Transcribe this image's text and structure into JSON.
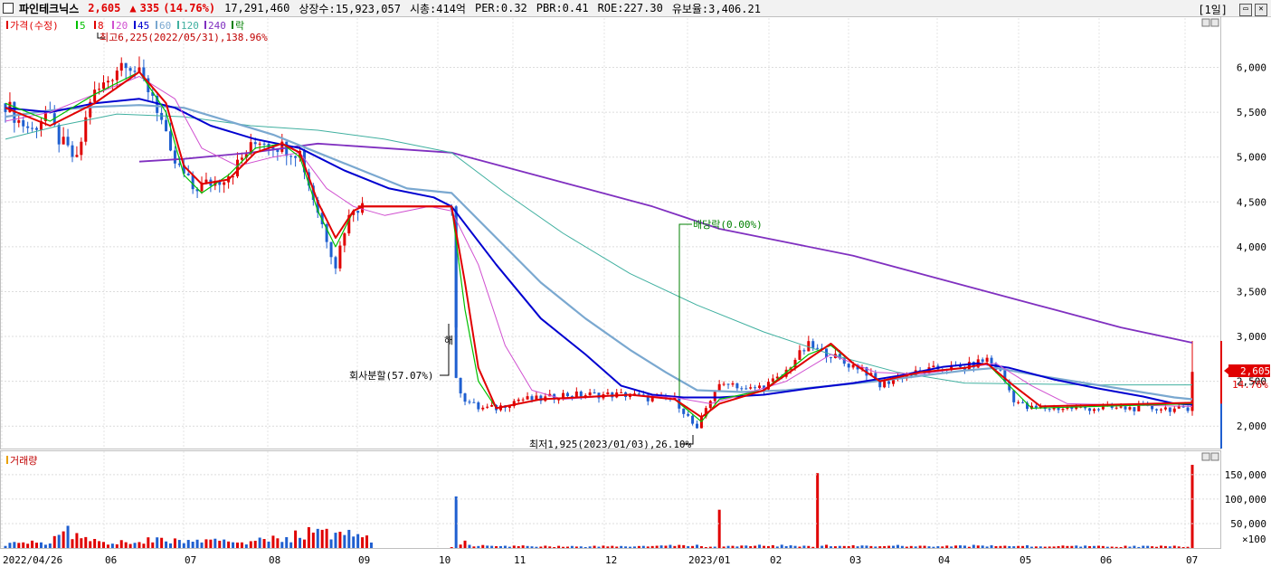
{
  "header": {
    "name": "파인테크닉스",
    "price": "2,605",
    "arrow": "▲",
    "change": "335",
    "change_pct": "(14.76%)",
    "volume": "17,291,460",
    "listed": "상장수:15,923,057",
    "mcap": "시총:414억",
    "per": "PER:0.32",
    "pbr": "PBR:0.41",
    "roe": "ROE:227.30",
    "reserve": "유보율:3,406.21",
    "period": "[1일]"
  },
  "legend": {
    "price_label": "가격(수정)",
    "ma": [
      "5",
      "8",
      "20",
      "45",
      "60",
      "120",
      "240"
    ],
    "ex_label": "락",
    "colors": {
      "ma5": "#00c000",
      "ma8": "#e00000",
      "ma20": "#d050d0",
      "ma45": "#0000d0",
      "ma60": "#7aa8d0",
      "ma120": "#40b0a0",
      "ma240": "#8030c0"
    }
  },
  "annotations": {
    "high": "최고6,225(2022/05/31),138.96%",
    "low": "최저1,925(2023/01/03),26.10%",
    "split": "회사분할(57.07%)",
    "split_mark": "해",
    "dividend": "배당락(0.00%)",
    "last_price": "2,605",
    "last_pct": "14.76%"
  },
  "volume_panel": {
    "label": "거래량",
    "unit": "×100",
    "ticks": [
      "150,000",
      "100,000",
      "50,000"
    ]
  },
  "chart_data": {
    "type": "candlestick",
    "y_ticks": [
      2000,
      2500,
      3000,
      3500,
      4000,
      4500,
      5000,
      5500,
      6000
    ],
    "ylim": [
      1750,
      6550
    ],
    "x_labels": [
      "2022/04/26",
      "06",
      "07",
      "08",
      "09",
      "10",
      "11",
      "12",
      "2023/01",
      "02",
      "03",
      "04",
      "05",
      "06",
      "07"
    ],
    "price_path": [
      [
        0,
        5600
      ],
      [
        3,
        5400
      ],
      [
        6,
        5300
      ],
      [
        9,
        5500
      ],
      [
        12,
        5200
      ],
      [
        16,
        4950
      ],
      [
        19,
        5650
      ],
      [
        22,
        5800
      ],
      [
        25,
        6000
      ],
      [
        27,
        6100
      ],
      [
        30,
        5900
      ],
      [
        33,
        5700
      ],
      [
        35,
        5400
      ],
      [
        37,
        5000
      ],
      [
        40,
        4800
      ],
      [
        42,
        4650
      ],
      [
        45,
        4700
      ],
      [
        48,
        4750
      ],
      [
        51,
        4850
      ],
      [
        54,
        5050
      ],
      [
        57,
        5200
      ],
      [
        60,
        5150
      ],
      [
        63,
        5100
      ],
      [
        66,
        5050
      ],
      [
        68,
        4700
      ],
      [
        70,
        4400
      ],
      [
        72,
        4100
      ],
      [
        74,
        3800
      ],
      [
        76,
        4200
      ],
      [
        78,
        4450
      ],
      [
        80,
        4450
      ],
      [
        100,
        4450
      ],
      [
        101,
        2500
      ],
      [
        103,
        2300
      ],
      [
        106,
        2200
      ],
      [
        110,
        2200
      ],
      [
        115,
        2300
      ],
      [
        120,
        2300
      ],
      [
        125,
        2350
      ],
      [
        130,
        2350
      ],
      [
        135,
        2350
      ],
      [
        140,
        2350
      ],
      [
        145,
        2300
      ],
      [
        150,
        2300
      ],
      [
        153,
        2100
      ],
      [
        155,
        1950
      ],
      [
        157,
        2200
      ],
      [
        159,
        2400
      ],
      [
        162,
        2500
      ],
      [
        166,
        2400
      ],
      [
        170,
        2450
      ],
      [
        174,
        2550
      ],
      [
        177,
        2750
      ],
      [
        180,
        2900
      ],
      [
        182,
        2850
      ],
      [
        185,
        2800
      ],
      [
        188,
        2700
      ],
      [
        192,
        2650
      ],
      [
        196,
        2450
      ],
      [
        200,
        2550
      ],
      [
        205,
        2600
      ],
      [
        210,
        2650
      ],
      [
        215,
        2650
      ],
      [
        220,
        2750
      ],
      [
        223,
        2600
      ],
      [
        226,
        2300
      ],
      [
        229,
        2200
      ],
      [
        234,
        2200
      ],
      [
        240,
        2200
      ],
      [
        245,
        2200
      ],
      [
        250,
        2200
      ],
      [
        255,
        2200
      ],
      [
        260,
        2200
      ],
      [
        265,
        2170
      ],
      [
        266,
        2605
      ]
    ],
    "ma5": [
      [
        0,
        5600
      ],
      [
        10,
        5400
      ],
      [
        20,
        5700
      ],
      [
        30,
        5950
      ],
      [
        36,
        5500
      ],
      [
        40,
        4800
      ],
      [
        44,
        4600
      ],
      [
        50,
        4800
      ],
      [
        56,
        5100
      ],
      [
        62,
        5150
      ],
      [
        66,
        5000
      ],
      [
        70,
        4400
      ],
      [
        74,
        4000
      ],
      [
        78,
        4400
      ],
      [
        80,
        4450
      ],
      [
        100,
        4450
      ],
      [
        103,
        3300
      ],
      [
        106,
        2500
      ],
      [
        110,
        2200
      ],
      [
        120,
        2300
      ],
      [
        140,
        2350
      ],
      [
        150,
        2300
      ],
      [
        156,
        2050
      ],
      [
        160,
        2300
      ],
      [
        170,
        2400
      ],
      [
        180,
        2800
      ],
      [
        185,
        2900
      ],
      [
        190,
        2700
      ],
      [
        196,
        2500
      ],
      [
        205,
        2600
      ],
      [
        215,
        2650
      ],
      [
        220,
        2700
      ],
      [
        226,
        2400
      ],
      [
        230,
        2200
      ],
      [
        266,
        2250
      ]
    ],
    "ma8": [
      [
        0,
        5550
      ],
      [
        10,
        5350
      ],
      [
        20,
        5600
      ],
      [
        30,
        5950
      ],
      [
        36,
        5600
      ],
      [
        40,
        4900
      ],
      [
        44,
        4700
      ],
      [
        50,
        4750
      ],
      [
        56,
        5050
      ],
      [
        62,
        5150
      ],
      [
        66,
        5050
      ],
      [
        70,
        4500
      ],
      [
        74,
        4100
      ],
      [
        78,
        4400
      ],
      [
        80,
        4450
      ],
      [
        100,
        4450
      ],
      [
        103,
        3600
      ],
      [
        106,
        2650
      ],
      [
        110,
        2200
      ],
      [
        120,
        2300
      ],
      [
        140,
        2350
      ],
      [
        150,
        2300
      ],
      [
        156,
        2100
      ],
      [
        160,
        2250
      ],
      [
        170,
        2400
      ],
      [
        180,
        2750
      ],
      [
        185,
        2920
      ],
      [
        190,
        2700
      ],
      [
        196,
        2500
      ],
      [
        205,
        2600
      ],
      [
        215,
        2650
      ],
      [
        220,
        2700
      ],
      [
        226,
        2450
      ],
      [
        232,
        2220
      ],
      [
        266,
        2260
      ]
    ],
    "ma20": [
      [
        0,
        5400
      ],
      [
        10,
        5500
      ],
      [
        20,
        5700
      ],
      [
        30,
        5900
      ],
      [
        38,
        5650
      ],
      [
        44,
        5100
      ],
      [
        52,
        4900
      ],
      [
        60,
        5000
      ],
      [
        66,
        5050
      ],
      [
        72,
        4650
      ],
      [
        78,
        4450
      ],
      [
        85,
        4350
      ],
      [
        95,
        4450
      ],
      [
        100,
        4400
      ],
      [
        106,
        3800
      ],
      [
        112,
        2900
      ],
      [
        118,
        2400
      ],
      [
        125,
        2300
      ],
      [
        140,
        2350
      ],
      [
        150,
        2320
      ],
      [
        158,
        2250
      ],
      [
        165,
        2350
      ],
      [
        175,
        2500
      ],
      [
        185,
        2800
      ],
      [
        195,
        2600
      ],
      [
        205,
        2580
      ],
      [
        215,
        2650
      ],
      [
        222,
        2700
      ],
      [
        230,
        2450
      ],
      [
        238,
        2250
      ],
      [
        266,
        2220
      ]
    ],
    "ma45": [
      [
        0,
        5550
      ],
      [
        10,
        5500
      ],
      [
        20,
        5600
      ],
      [
        30,
        5650
      ],
      [
        38,
        5550
      ],
      [
        46,
        5350
      ],
      [
        56,
        5200
      ],
      [
        66,
        5100
      ],
      [
        76,
        4850
      ],
      [
        86,
        4650
      ],
      [
        96,
        4550
      ],
      [
        100,
        4450
      ],
      [
        110,
        3800
      ],
      [
        120,
        3200
      ],
      [
        130,
        2800
      ],
      [
        138,
        2450
      ],
      [
        145,
        2350
      ],
      [
        152,
        2320
      ],
      [
        160,
        2320
      ],
      [
        170,
        2350
      ],
      [
        180,
        2420
      ],
      [
        190,
        2480
      ],
      [
        200,
        2560
      ],
      [
        210,
        2660
      ],
      [
        218,
        2700
      ],
      [
        225,
        2650
      ],
      [
        235,
        2520
      ],
      [
        245,
        2420
      ],
      [
        255,
        2330
      ],
      [
        262,
        2250
      ],
      [
        266,
        2240
      ]
    ],
    "ma60": [
      [
        0,
        5450
      ],
      [
        10,
        5520
      ],
      [
        20,
        5560
      ],
      [
        30,
        5580
      ],
      [
        40,
        5550
      ],
      [
        50,
        5400
      ],
      [
        60,
        5250
      ],
      [
        70,
        5050
      ],
      [
        80,
        4850
      ],
      [
        90,
        4650
      ],
      [
        100,
        4600
      ],
      [
        110,
        4100
      ],
      [
        120,
        3600
      ],
      [
        130,
        3200
      ],
      [
        140,
        2850
      ],
      [
        148,
        2600
      ],
      [
        155,
        2400
      ],
      [
        165,
        2380
      ],
      [
        175,
        2400
      ],
      [
        185,
        2450
      ],
      [
        195,
        2500
      ],
      [
        205,
        2560
      ],
      [
        215,
        2620
      ],
      [
        222,
        2650
      ],
      [
        232,
        2560
      ],
      [
        242,
        2480
      ],
      [
        252,
        2400
      ],
      [
        262,
        2320
      ],
      [
        266,
        2300
      ]
    ],
    "ma120": [
      [
        0,
        5200
      ],
      [
        12,
        5350
      ],
      [
        25,
        5480
      ],
      [
        40,
        5450
      ],
      [
        55,
        5350
      ],
      [
        70,
        5300
      ],
      [
        85,
        5200
      ],
      [
        100,
        5050
      ],
      [
        112,
        4600
      ],
      [
        125,
        4150
      ],
      [
        140,
        3700
      ],
      [
        155,
        3350
      ],
      [
        170,
        3050
      ],
      [
        185,
        2800
      ],
      [
        200,
        2600
      ],
      [
        215,
        2480
      ],
      [
        230,
        2470
      ],
      [
        245,
        2460
      ],
      [
        266,
        2460
      ]
    ],
    "ma240": [
      [
        30,
        4950
      ],
      [
        40,
        4980
      ],
      [
        55,
        5050
      ],
      [
        70,
        5150
      ],
      [
        85,
        5100
      ],
      [
        100,
        5050
      ],
      [
        115,
        4850
      ],
      [
        130,
        4650
      ],
      [
        145,
        4450
      ],
      [
        160,
        4200
      ],
      [
        175,
        4050
      ],
      [
        190,
        3900
      ],
      [
        205,
        3700
      ],
      [
        220,
        3500
      ],
      [
        235,
        3300
      ],
      [
        250,
        3100
      ],
      [
        266,
        2930
      ]
    ],
    "volume_rel": [
      [
        0,
        0.05
      ],
      [
        10,
        0.07
      ],
      [
        13,
        0.2
      ],
      [
        18,
        0.12
      ],
      [
        25,
        0.06
      ],
      [
        33,
        0.1
      ],
      [
        40,
        0.08
      ],
      [
        49,
        0.08
      ],
      [
        56,
        0.08
      ],
      [
        63,
        0.12
      ],
      [
        68,
        0.18
      ],
      [
        70,
        0.23
      ],
      [
        72,
        0.16
      ],
      [
        74,
        0.14
      ],
      [
        76,
        0.2
      ],
      [
        78,
        0.15
      ],
      [
        80,
        0.16
      ],
      [
        83,
        0.01
      ],
      [
        100,
        0.01
      ],
      [
        101,
        0.62
      ],
      [
        102,
        0.08
      ],
      [
        104,
        0.04
      ],
      [
        112,
        0.09
      ],
      [
        120,
        0.02
      ],
      [
        140,
        0.02
      ],
      [
        155,
        0.03
      ],
      [
        160,
        0.46
      ],
      [
        162,
        0.08
      ],
      [
        176,
        0.04
      ],
      [
        182,
        0.9
      ],
      [
        183,
        0.04
      ],
      [
        218,
        0.06
      ],
      [
        230,
        0.02
      ],
      [
        266,
        1.0
      ]
    ]
  }
}
